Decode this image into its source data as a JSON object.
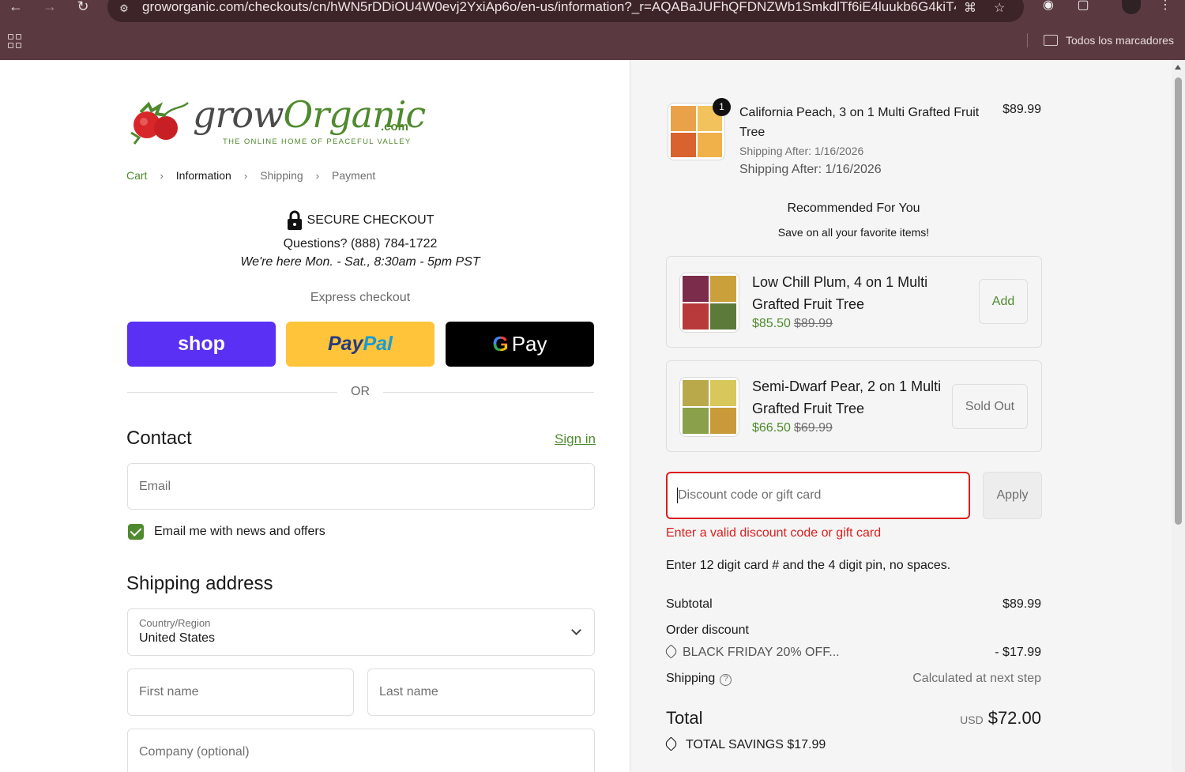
{
  "browser": {
    "url": "groworganic.com/checkouts/cn/hWN5rDDiOU4W0evj2YxiAp6o/en-us/information?_r=AQABaJUFhQFDNZWb1SmkdlTf6iE4luukb6G4kiT442...",
    "bookmarks_label": "Todos los marcadores",
    "icons": [
      "back-icon",
      "forward-icon",
      "reload-icon",
      "site-info-icon",
      "translate-icon",
      "star-icon",
      "extension-icon",
      "puzzle-icon",
      "profile-avatar",
      "menu-icon",
      "apps-icon",
      "folder-icon"
    ]
  },
  "logo": {
    "word_a": "grow",
    "word_o": "Organic",
    "com": ".com",
    "tagline": "THE ONLINE HOME OF PEACEFUL VALLEY"
  },
  "breadcrumb": [
    "Cart",
    "Information",
    "Shipping",
    "Payment"
  ],
  "secure": {
    "label": "SECURE CHECKOUT",
    "phone": "Questions? (888) 784-1722",
    "hours": "We're here Mon. - Sat., 8:30am - 5pm PST"
  },
  "express": {
    "label": "Express checkout",
    "shop": "shop",
    "paypal_a": "Pay",
    "paypal_b": "Pal",
    "gpay_g": "G",
    "gpay": "Pay",
    "or": "OR"
  },
  "contact": {
    "title": "Contact",
    "signin": "Sign in",
    "email_placeholder": "Email",
    "newsletter_label": "Email me with news and offers",
    "newsletter_checked": true
  },
  "shipping": {
    "title": "Shipping address",
    "country_label": "Country/Region",
    "country_value": "United States",
    "first_name_placeholder": "First name",
    "last_name_placeholder": "Last name",
    "company_placeholder": "Company (optional)"
  },
  "cart": {
    "item": {
      "quantity": "1",
      "title": "California Peach, 3 on 1 Multi Grafted Fruit Tree",
      "price": "$89.99",
      "shipping_small": "Shipping After: 1/16/2026",
      "shipping_large": "Shipping After: 1/16/2026"
    },
    "recommended_title": "Recommended For You",
    "recommended_sub": "Save on all your favorite items!",
    "recommendations": [
      {
        "name": "Low Chill Plum, 4 on 1 Multi Grafted Fruit Tree",
        "sale": "$85.50",
        "was": "$89.99",
        "button": "Add"
      },
      {
        "name": "Semi-Dwarf Pear, 2 on 1 Multi Grafted Fruit Tree",
        "sale": "$66.50",
        "was": "$69.99",
        "button": "Sold Out"
      }
    ],
    "discount_placeholder": "Discount code or gift card",
    "apply": "Apply",
    "error": "Enter a valid discount code or gift card",
    "hint": "Enter 12 digit card # and the 4 digit pin, no spaces.",
    "subtotal_label": "Subtotal",
    "subtotal": "$89.99",
    "order_discount_label": "Order discount",
    "discount_code": "BLACK FRIDAY 20% OFF...",
    "discount_amount": "- $17.99",
    "shipping_label": "Shipping",
    "shipping_value": "Calculated at next step",
    "total_label": "Total",
    "currency": "USD",
    "total": "$72.00",
    "savings_label": "TOTAL SAVINGS",
    "savings": "$17.99"
  },
  "colors": {
    "brand_green": "#4f8a2e",
    "error_red": "#dd1d1d",
    "shop_purple": "#5a31f4",
    "paypal_yellow": "#ffc439",
    "chrome": "#5a3a40"
  }
}
